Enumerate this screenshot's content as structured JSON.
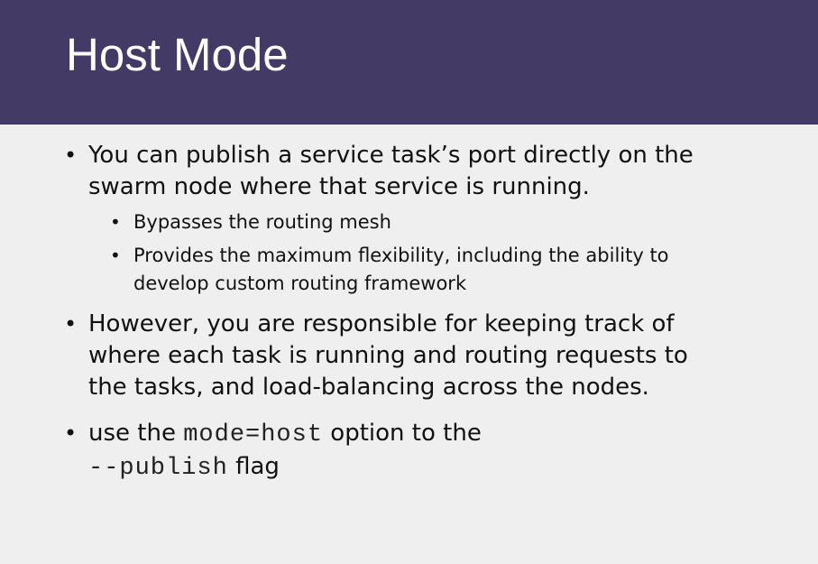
{
  "slide": {
    "title": "Host Mode",
    "bullets": [
      {
        "text": "You can publish a service task’s port directly on the swarm node where that service is running.",
        "subbullets": [
          "Bypasses the routing mesh",
          "Provides the maximum flexibility, including the ability to develop custom routing framework"
        ]
      },
      {
        "text": "However, you are responsible for keeping track of where each task is running and routing requests to the tasks, and load-balancing across the nodes."
      },
      {
        "parts": {
          "prefix": "use the ",
          "code1": "mode=host",
          "middle": " option to the",
          "code2": "--publish",
          "suffix": " flag"
        }
      }
    ],
    "bullet_symbol": "•",
    "colors": {
      "title_bar": "#433a66",
      "title_text": "#ffffff",
      "background": "#efefef",
      "body_text": "#111111"
    }
  }
}
